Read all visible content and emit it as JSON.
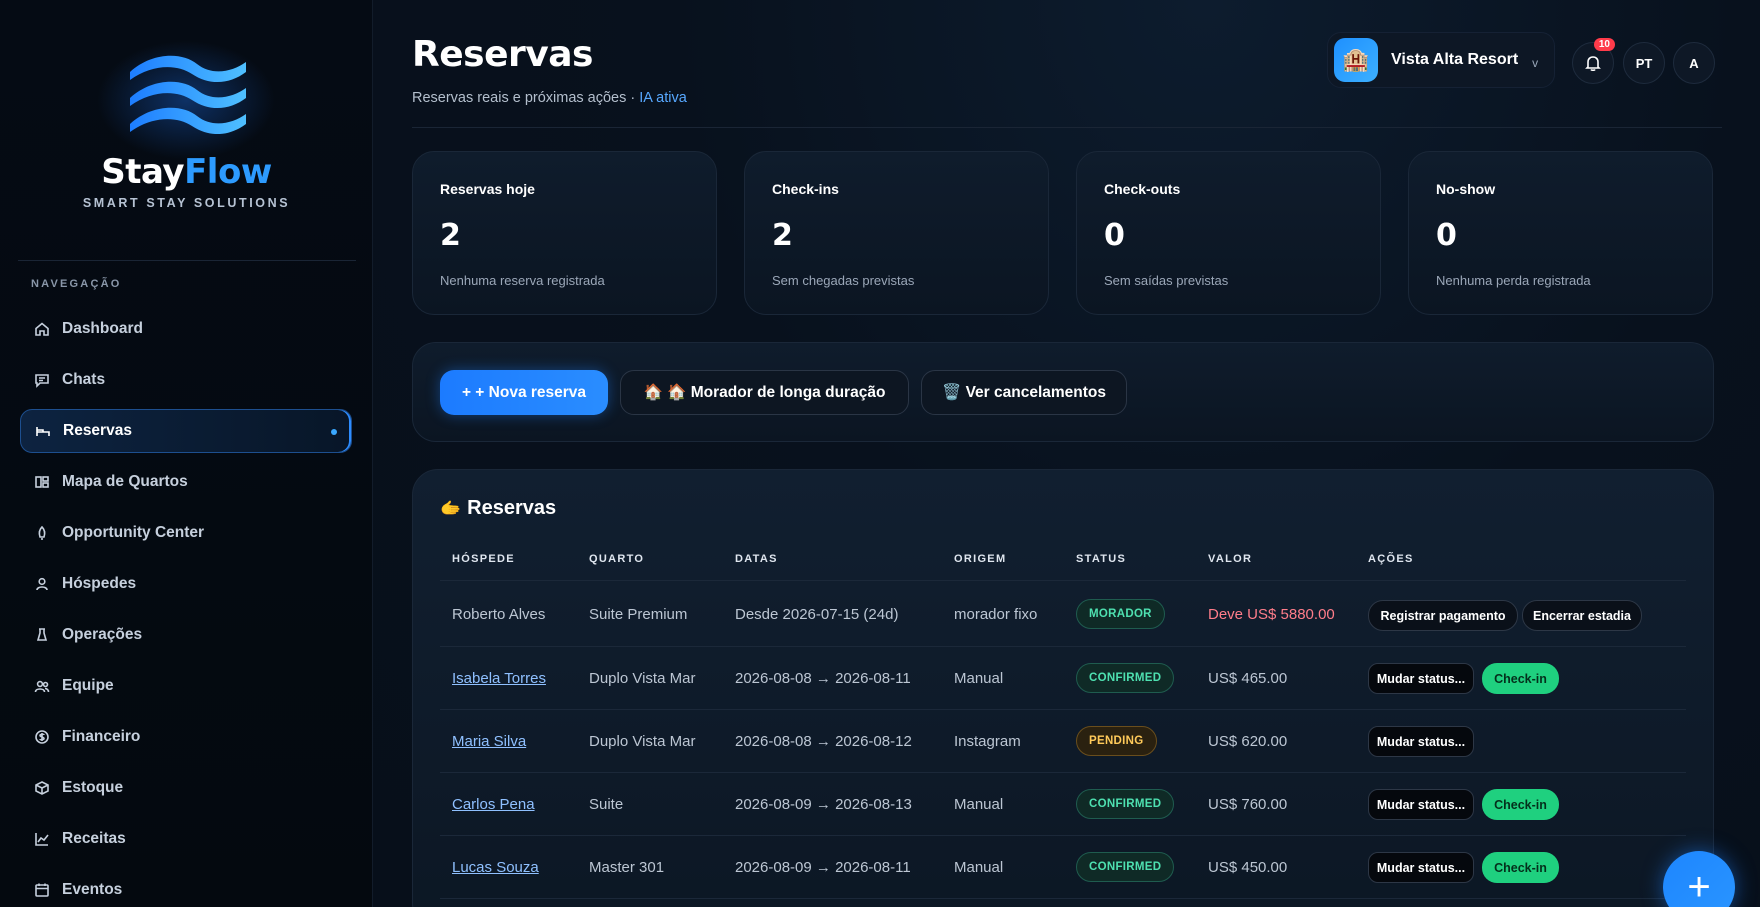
{
  "sidebar": {
    "brand_part1": "Stay",
    "brand_part2": "Flow",
    "tagline": "SMART STAY SOLUTIONS",
    "nav_title": "NAVEGAÇÃO",
    "items": [
      {
        "label": "Dashboard",
        "icon": "home-icon"
      },
      {
        "label": "Chats",
        "icon": "chat-icon"
      },
      {
        "label": "Reservas",
        "icon": "bed-icon",
        "active": true
      },
      {
        "label": "Mapa de Quartos",
        "icon": "map-icon"
      },
      {
        "label": "Opportunity Center",
        "icon": "rocket-icon"
      },
      {
        "label": "Hóspedes",
        "icon": "user-icon"
      },
      {
        "label": "Operações",
        "icon": "flask-icon"
      },
      {
        "label": "Equipe",
        "icon": "team-icon"
      },
      {
        "label": "Financeiro",
        "icon": "dollar-icon"
      },
      {
        "label": "Estoque",
        "icon": "box-icon"
      },
      {
        "label": "Receitas",
        "icon": "chart-icon"
      },
      {
        "label": "Eventos",
        "icon": "calendar-icon"
      }
    ]
  },
  "header": {
    "title": "Reservas",
    "subtitle": "Reservas reais e próximas ações · ",
    "subtitle_ia": "IA ativa",
    "hotel_name": "Vista Alta Resort",
    "hotel_icon": "🏨",
    "hotel_chevron": "v",
    "notifications_count": "10",
    "lang": "PT",
    "avatar": "A"
  },
  "kpis": [
    {
      "label": "Reservas hoje",
      "value": "2",
      "note": "Nenhuma reserva registrada"
    },
    {
      "label": "Check-ins",
      "value": "2",
      "note": "Sem chegadas previstas"
    },
    {
      "label": "Check-outs",
      "value": "0",
      "note": "Sem saídas previstas"
    },
    {
      "label": "No-show",
      "value": "0",
      "note": "Nenhuma perda registrada"
    }
  ],
  "actions": {
    "new_reservation": "+ + Nova reserva",
    "long_stay": "🏠 🏠 Morador de longa duração",
    "cancellations": "🗑️ Ver cancelamentos"
  },
  "table": {
    "title": "Reservas",
    "title_icon": "🫱",
    "headers": [
      "HÓSPEDE",
      "QUARTO",
      "DATAS",
      "ORIGEM",
      "STATUS",
      "VALOR",
      "AÇÕES"
    ],
    "rows": [
      {
        "guest": "Roberto Alves",
        "room": "Suite Premium",
        "dates": "Desde 2026-07-15 (24d)",
        "origin": "morador fixo",
        "status": "MORADOR",
        "value": "Deve US$ 5880.00",
        "action1": "Registrar pagamento",
        "action2": "Encerrar estadia"
      },
      {
        "guest": "Isabela Torres",
        "room": "Duplo Vista Mar",
        "dates": "2026-08-08 → 2026-08-11",
        "origin": "Manual",
        "status": "CONFIRMED",
        "value": "US$ 465.00",
        "action1": "Mudar status...",
        "action2": "Check-in"
      },
      {
        "guest": "Maria Silva",
        "room": "Duplo Vista Mar",
        "dates": "2026-08-08 → 2026-08-12",
        "origin": "Instagram",
        "status": "PENDING",
        "value": "US$ 620.00",
        "action1": "Mudar status...",
        "action2": ""
      },
      {
        "guest": "Carlos Pena",
        "room": "Suite",
        "dates": "2026-08-09 → 2026-08-13",
        "origin": "Manual",
        "status": "CONFIRMED",
        "value": "US$ 760.00",
        "action1": "Mudar status...",
        "action2": "Check-in"
      },
      {
        "guest": "Lucas Souza",
        "room": "Master 301",
        "dates": "2026-08-09 → 2026-08-11",
        "origin": "Manual",
        "status": "CONFIRMED",
        "value": "US$ 450.00",
        "action1": "Mudar status...",
        "action2": "Check-in"
      }
    ]
  },
  "fab": {
    "label": "+"
  }
}
